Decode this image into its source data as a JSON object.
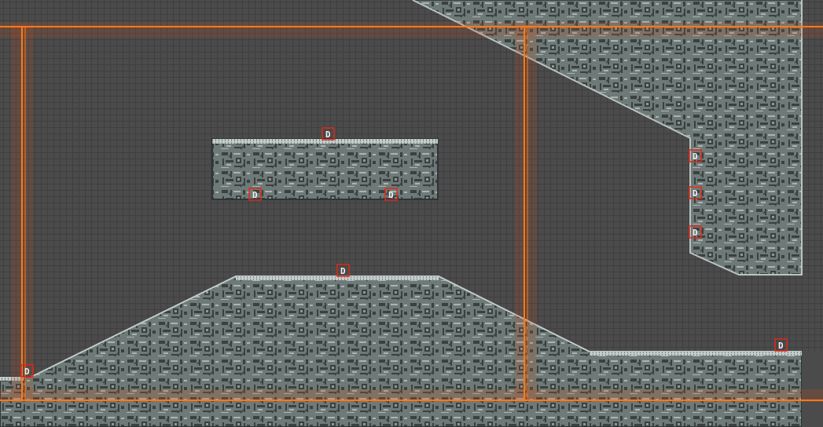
{
  "scene": {
    "view": "level-editor-canvas",
    "grid": true,
    "colors": {
      "background": "#4b4b4b",
      "grid_line": "#3f3f3f",
      "boundary": "#ff7a1a",
      "boundary_glow": "#c8501a",
      "tile_fill": "#6e7a78",
      "tile_edge": "#b9c3c2",
      "tile_detail": "#3a4140",
      "marker_border": "#e02818"
    },
    "marker_icon": "door-marker-icon",
    "marker_glyph": "D",
    "markers": [
      {
        "id": "top-platform-top",
        "label": "D"
      },
      {
        "id": "top-platform-bottom-left",
        "label": "D"
      },
      {
        "id": "top-platform-bottom-right",
        "label": "D"
      },
      {
        "id": "right-wall-upper",
        "label": "D"
      },
      {
        "id": "right-wall-middle",
        "label": "D"
      },
      {
        "id": "right-wall-lower",
        "label": "D"
      },
      {
        "id": "hill-peak",
        "label": "D"
      },
      {
        "id": "ground-right",
        "label": "D"
      },
      {
        "id": "ground-left-edge",
        "label": "D"
      }
    ]
  }
}
